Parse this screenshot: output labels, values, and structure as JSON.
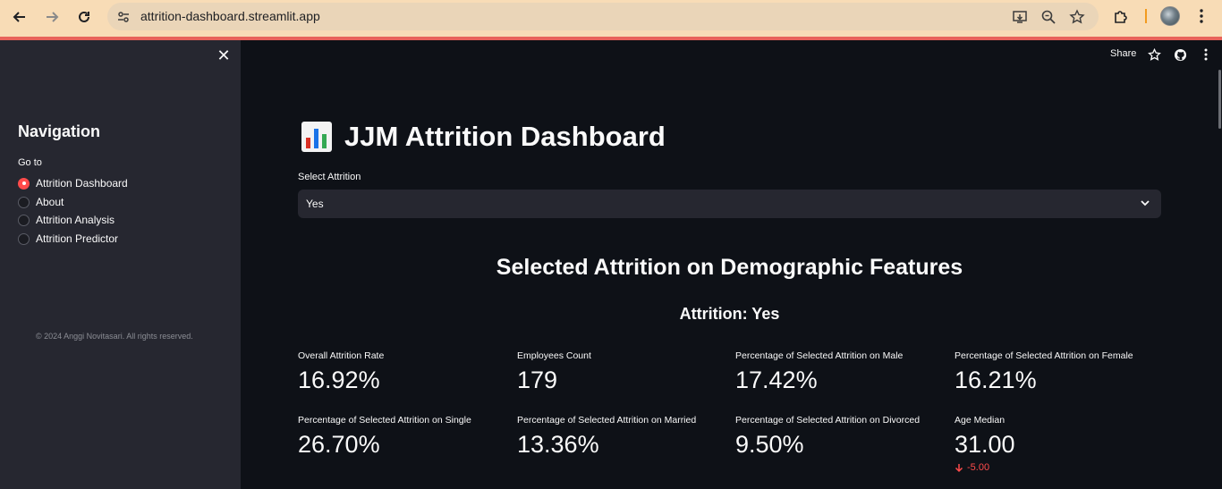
{
  "browser": {
    "url": "attrition-dashboard.streamlit.app"
  },
  "header": {
    "share_label": "Share"
  },
  "sidebar": {
    "title": "Navigation",
    "goto_label": "Go to",
    "items": [
      {
        "label": "Attrition Dashboard",
        "selected": true
      },
      {
        "label": "About",
        "selected": false
      },
      {
        "label": "Attrition Analysis",
        "selected": false
      },
      {
        "label": "Attrition Predictor",
        "selected": false
      }
    ],
    "footer": "© 2024 Anggi Novitasari. All rights reserved."
  },
  "main": {
    "title": "JJM Attrition Dashboard",
    "select_label": "Select Attrition",
    "select_value": "Yes",
    "section_title": "Selected Attrition on Demographic Features",
    "subsection_title": "Attrition: Yes",
    "metrics": [
      {
        "label": "Overall Attrition Rate",
        "value": "16.92%"
      },
      {
        "label": "Employees Count",
        "value": "179"
      },
      {
        "label": "Percentage of Selected Attrition on Male",
        "value": "17.42%"
      },
      {
        "label": "Percentage of Selected Attrition on Female",
        "value": "16.21%"
      },
      {
        "label": "Percentage of Selected Attrition on Single",
        "value": "26.70%"
      },
      {
        "label": "Percentage of Selected Attrition on Married",
        "value": "13.36%"
      },
      {
        "label": "Percentage of Selected Attrition on Divorced",
        "value": "9.50%"
      },
      {
        "label": "Age Median",
        "value": "31.00",
        "delta": "-5.00"
      }
    ]
  },
  "colors": {
    "accent": "#ff4b4b",
    "background": "#0e1117",
    "sidebar": "#262730"
  }
}
